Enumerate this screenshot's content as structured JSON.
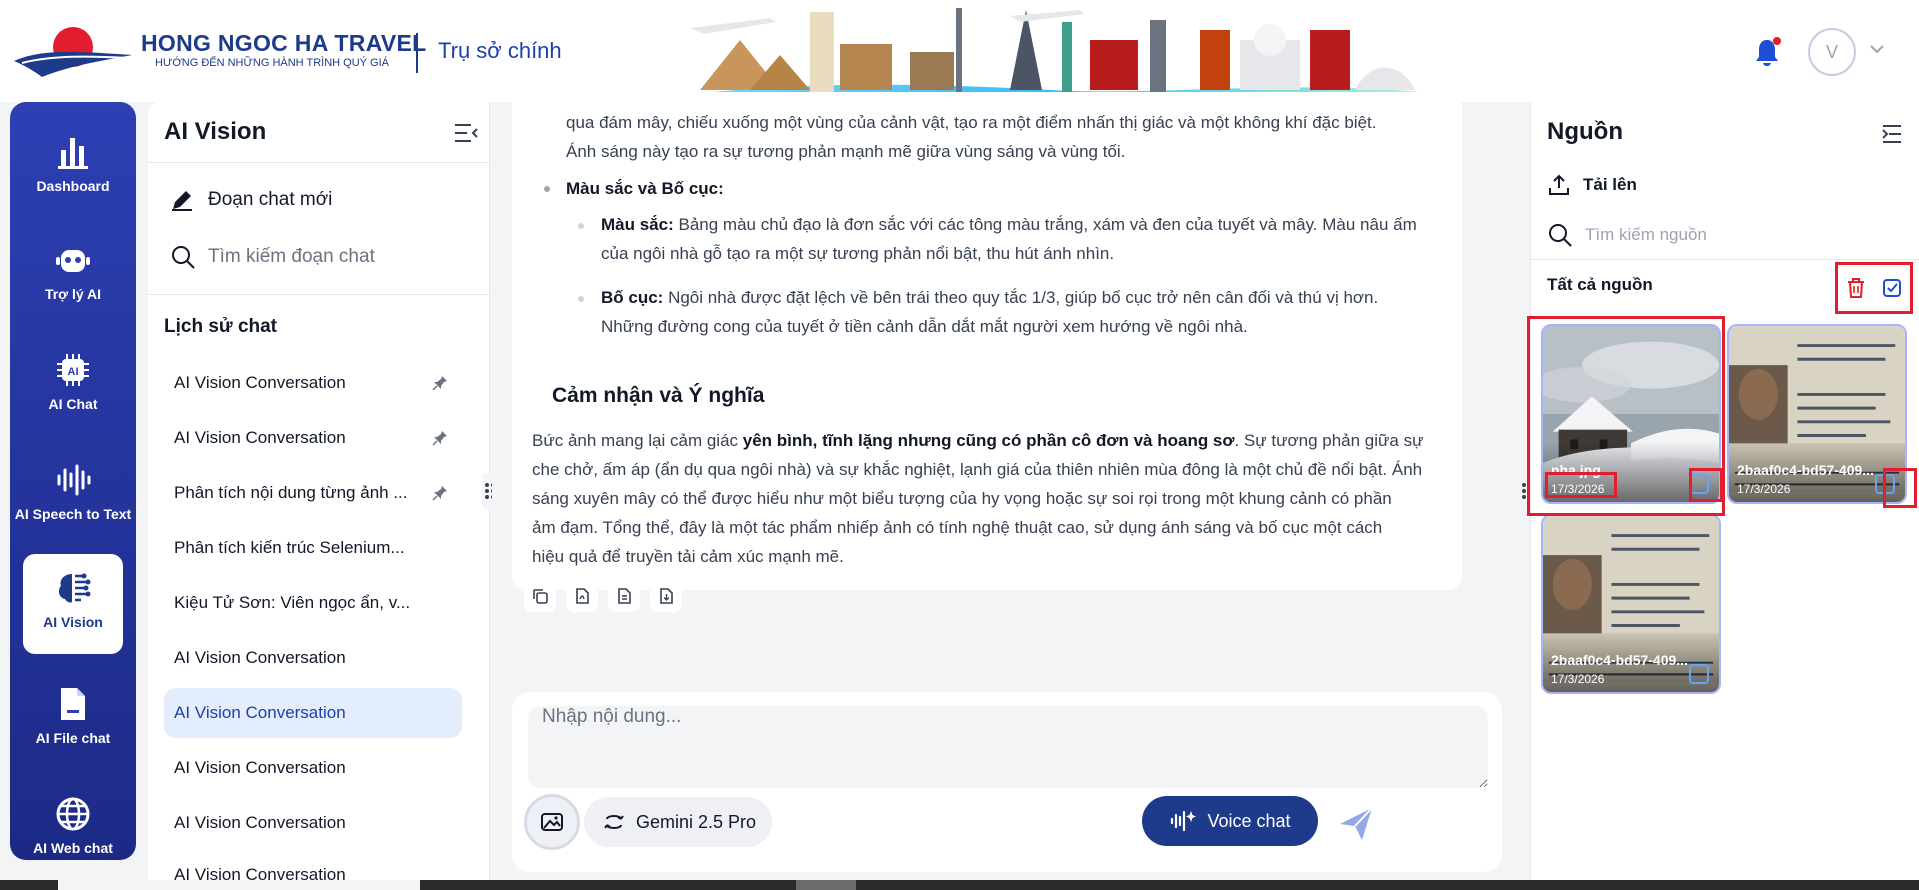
{
  "brand": {
    "name": "HONG NGOC HA TRAVEL",
    "slogan": "HƯỚNG ĐẾN NHỮNG HÀNH TRÌNH QUÝ GIÁ",
    "branch": "Trụ sở chính"
  },
  "user": {
    "avatar_initial": "V"
  },
  "nav": {
    "items": [
      {
        "label": "Dashboard",
        "icon": "bar-chart-icon"
      },
      {
        "label": "Trợ lý AI",
        "icon": "robot-icon"
      },
      {
        "label": "AI Chat",
        "icon": "ai-chip-icon"
      },
      {
        "label": "AI Speech to Text",
        "icon": "sound-wave-icon"
      },
      {
        "label": "AI Vision",
        "icon": "brain-icon",
        "active": true
      },
      {
        "label": "AI File chat",
        "icon": "file-icon"
      },
      {
        "label": "AI Web chat",
        "icon": "globe-icon"
      }
    ]
  },
  "history": {
    "title": "AI Vision",
    "new_chat": "Đoạn chat mới",
    "search_placeholder": "Tìm kiếm đoạn chat",
    "section_title": "Lịch sử chat",
    "items": [
      {
        "label": "AI Vision Conversation",
        "pinned": true
      },
      {
        "label": "AI Vision Conversation",
        "pinned": true
      },
      {
        "label": "Phân tích nội dung từng ảnh ...",
        "pinned": true
      },
      {
        "label": "Phân tích kiến trúc Selenium..."
      },
      {
        "label": "Kiệu Tử Sơn: Viên ngọc ẩn, v..."
      },
      {
        "label": "AI Vision Conversation"
      },
      {
        "label": "AI Vision Conversation",
        "active": true
      },
      {
        "label": "AI Vision Conversation"
      },
      {
        "label": "AI Vision Conversation"
      },
      {
        "label": "AI Vision Conversation"
      }
    ]
  },
  "message": {
    "light_line1": "qua đám mây, chiếu xuống một vùng của cảnh vật, tạo ra một điểm nhấn thị giác và một không khí đặc biệt.",
    "light_line2": "Ánh sáng này tạo ra sự tương phản mạnh mẽ giữa vùng sáng và vùng tối.",
    "color_heading": "Màu sắc và Bố cục:",
    "color_label": "Màu sắc:",
    "color_line1": "Bảng màu chủ đạo là đơn sắc với các tông màu trắng, xám và đen của tuyết và mây. Màu nâu ấm",
    "color_line2": "của ngôi nhà gỗ tạo ra một sự tương phản nổi bật, thu hút ánh nhìn.",
    "layout_label": "Bố cục:",
    "layout_line1": "Ngôi nhà được đặt lệch về bên trái theo quy tắc 1/3, giúp bố cục trở nên cân đối và thú vị hơn.",
    "layout_line2": "Những đường cong của tuyết ở tiền cảnh dẫn dắt mắt người xem hướng về ngôi nhà.",
    "section_heading": "Cảm nhận và Ý nghĩa",
    "para_start": "Bức ảnh mang lại cảm giác ",
    "para_bold": "yên bình, tĩnh lặng nhưng cũng có phần cô đơn và hoang sơ",
    "para_end": ". Sự tương phản giữa sự",
    "para_line2": "che chở, ấm áp (ẩn dụ qua ngôi nhà) và sự khắc nghiệt, lạnh giá của thiên nhiên mùa đông là một chủ đề nổi bật. Ánh",
    "para_line3": "sáng xuyên mây có thể được hiểu như một biểu tượng của hy vọng hoặc sự soi rọi trong một khung cảnh có phần",
    "para_line4": "ảm đạm. Tổng thể, đây là một tác phẩm nhiếp ảnh có tính nghệ thuật cao, sử dụng ánh sáng và bố cục một cách",
    "para_line5": "hiệu quả để truyền tải cảm xúc mạnh mẽ."
  },
  "composer": {
    "placeholder": "Nhập nội dung...",
    "model": "Gemini 2.5 Pro",
    "voice": "Voice chat"
  },
  "sources": {
    "title": "Nguồn",
    "upload": "Tải lên",
    "search_placeholder": "Tìm kiếm nguồn",
    "all_label": "Tất cả nguồn",
    "files": [
      {
        "name": "nha.jpg",
        "date": "17/3/2026"
      },
      {
        "name": "2baaf0c4-bd57-409...",
        "date": "17/3/2026"
      },
      {
        "name": "2baaf0c4-bd57-409...",
        "date": "17/3/2026"
      }
    ]
  },
  "colors": {
    "brand_blue": "#1e3a8a",
    "highlight_red": "#e11d2e",
    "active_item_bg": "#e3edfc"
  }
}
